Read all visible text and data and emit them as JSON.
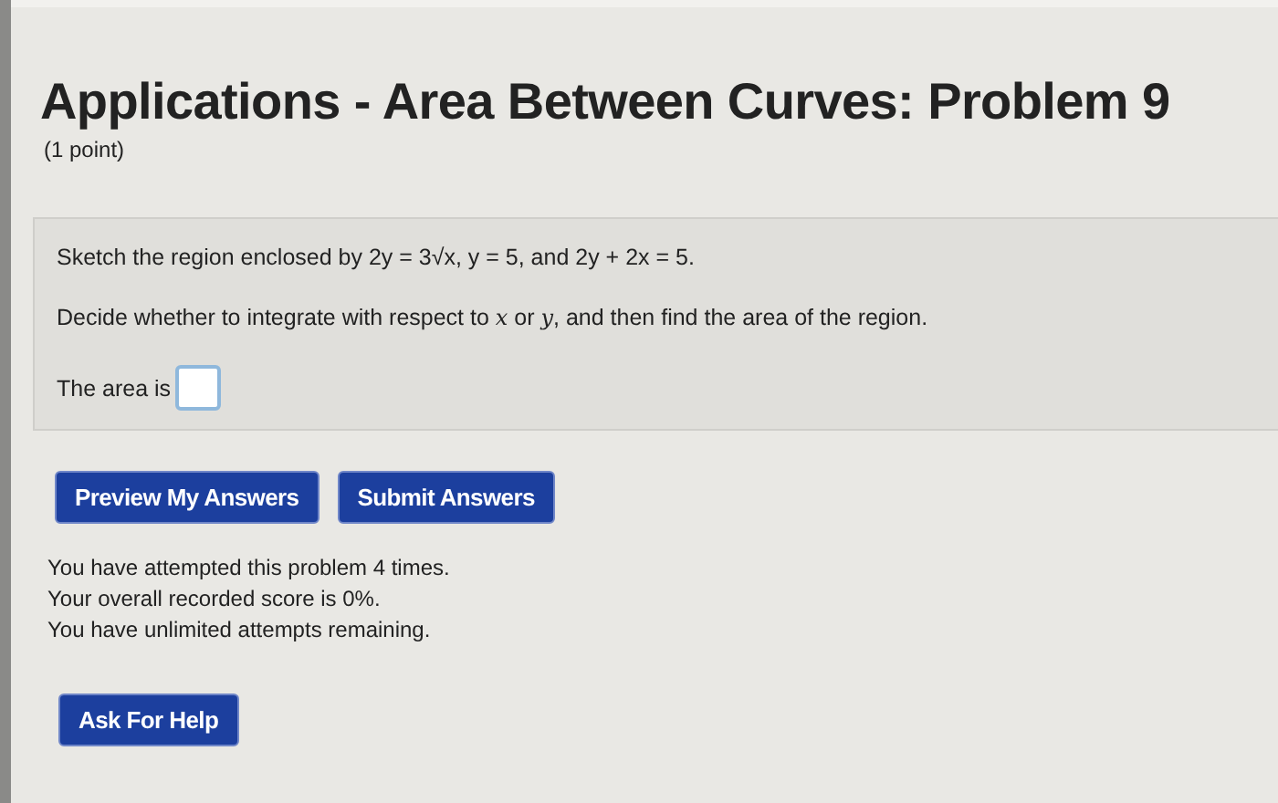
{
  "title": "Applications - Area Between Curves: Problem 9",
  "points": "(1 point)",
  "problem": {
    "statement": "Sketch the region enclosed by 2y = 3√x, y = 5, and 2y + 2x = 5.",
    "instruction": "Decide whether to integrate with respect to *x* or *y*, and then find the area of the region.",
    "answer_label": "The area is"
  },
  "buttons": [
    "Preview My Answers",
    "Submit Answers"
  ],
  "messages": [
    "You have attempted this problem 4 times.",
    "Your overall recorded score is 0%.",
    "You have unlimited attempts remaining."
  ],
  "help_button": "Ask For Help"
}
